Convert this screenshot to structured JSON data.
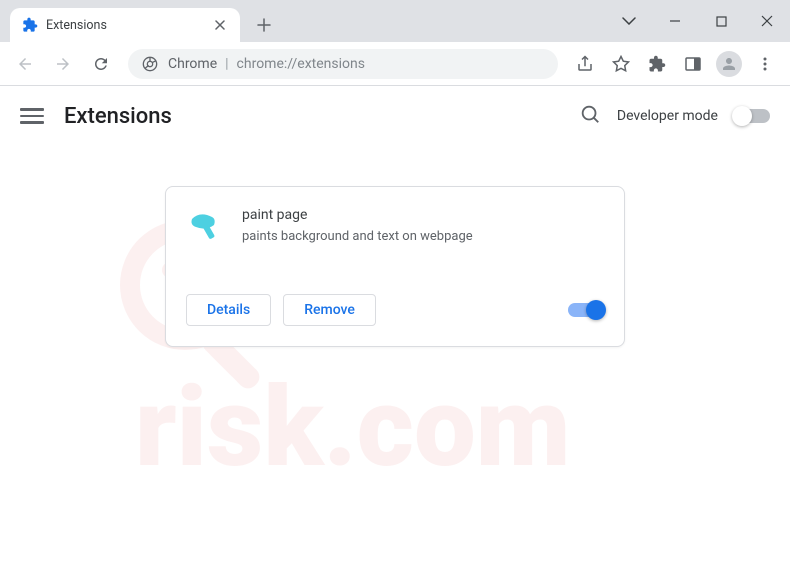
{
  "window": {
    "tab_title": "Extensions",
    "omnibox_prefix": "Chrome",
    "omnibox_url": "chrome://extensions"
  },
  "page": {
    "title": "Extensions",
    "developer_mode_label": "Developer mode"
  },
  "extension": {
    "name": "paint page",
    "description": "paints background and text on webpage",
    "details_label": "Details",
    "remove_label": "Remove",
    "enabled": true
  },
  "watermark": {
    "text": "PCrisk.com"
  }
}
